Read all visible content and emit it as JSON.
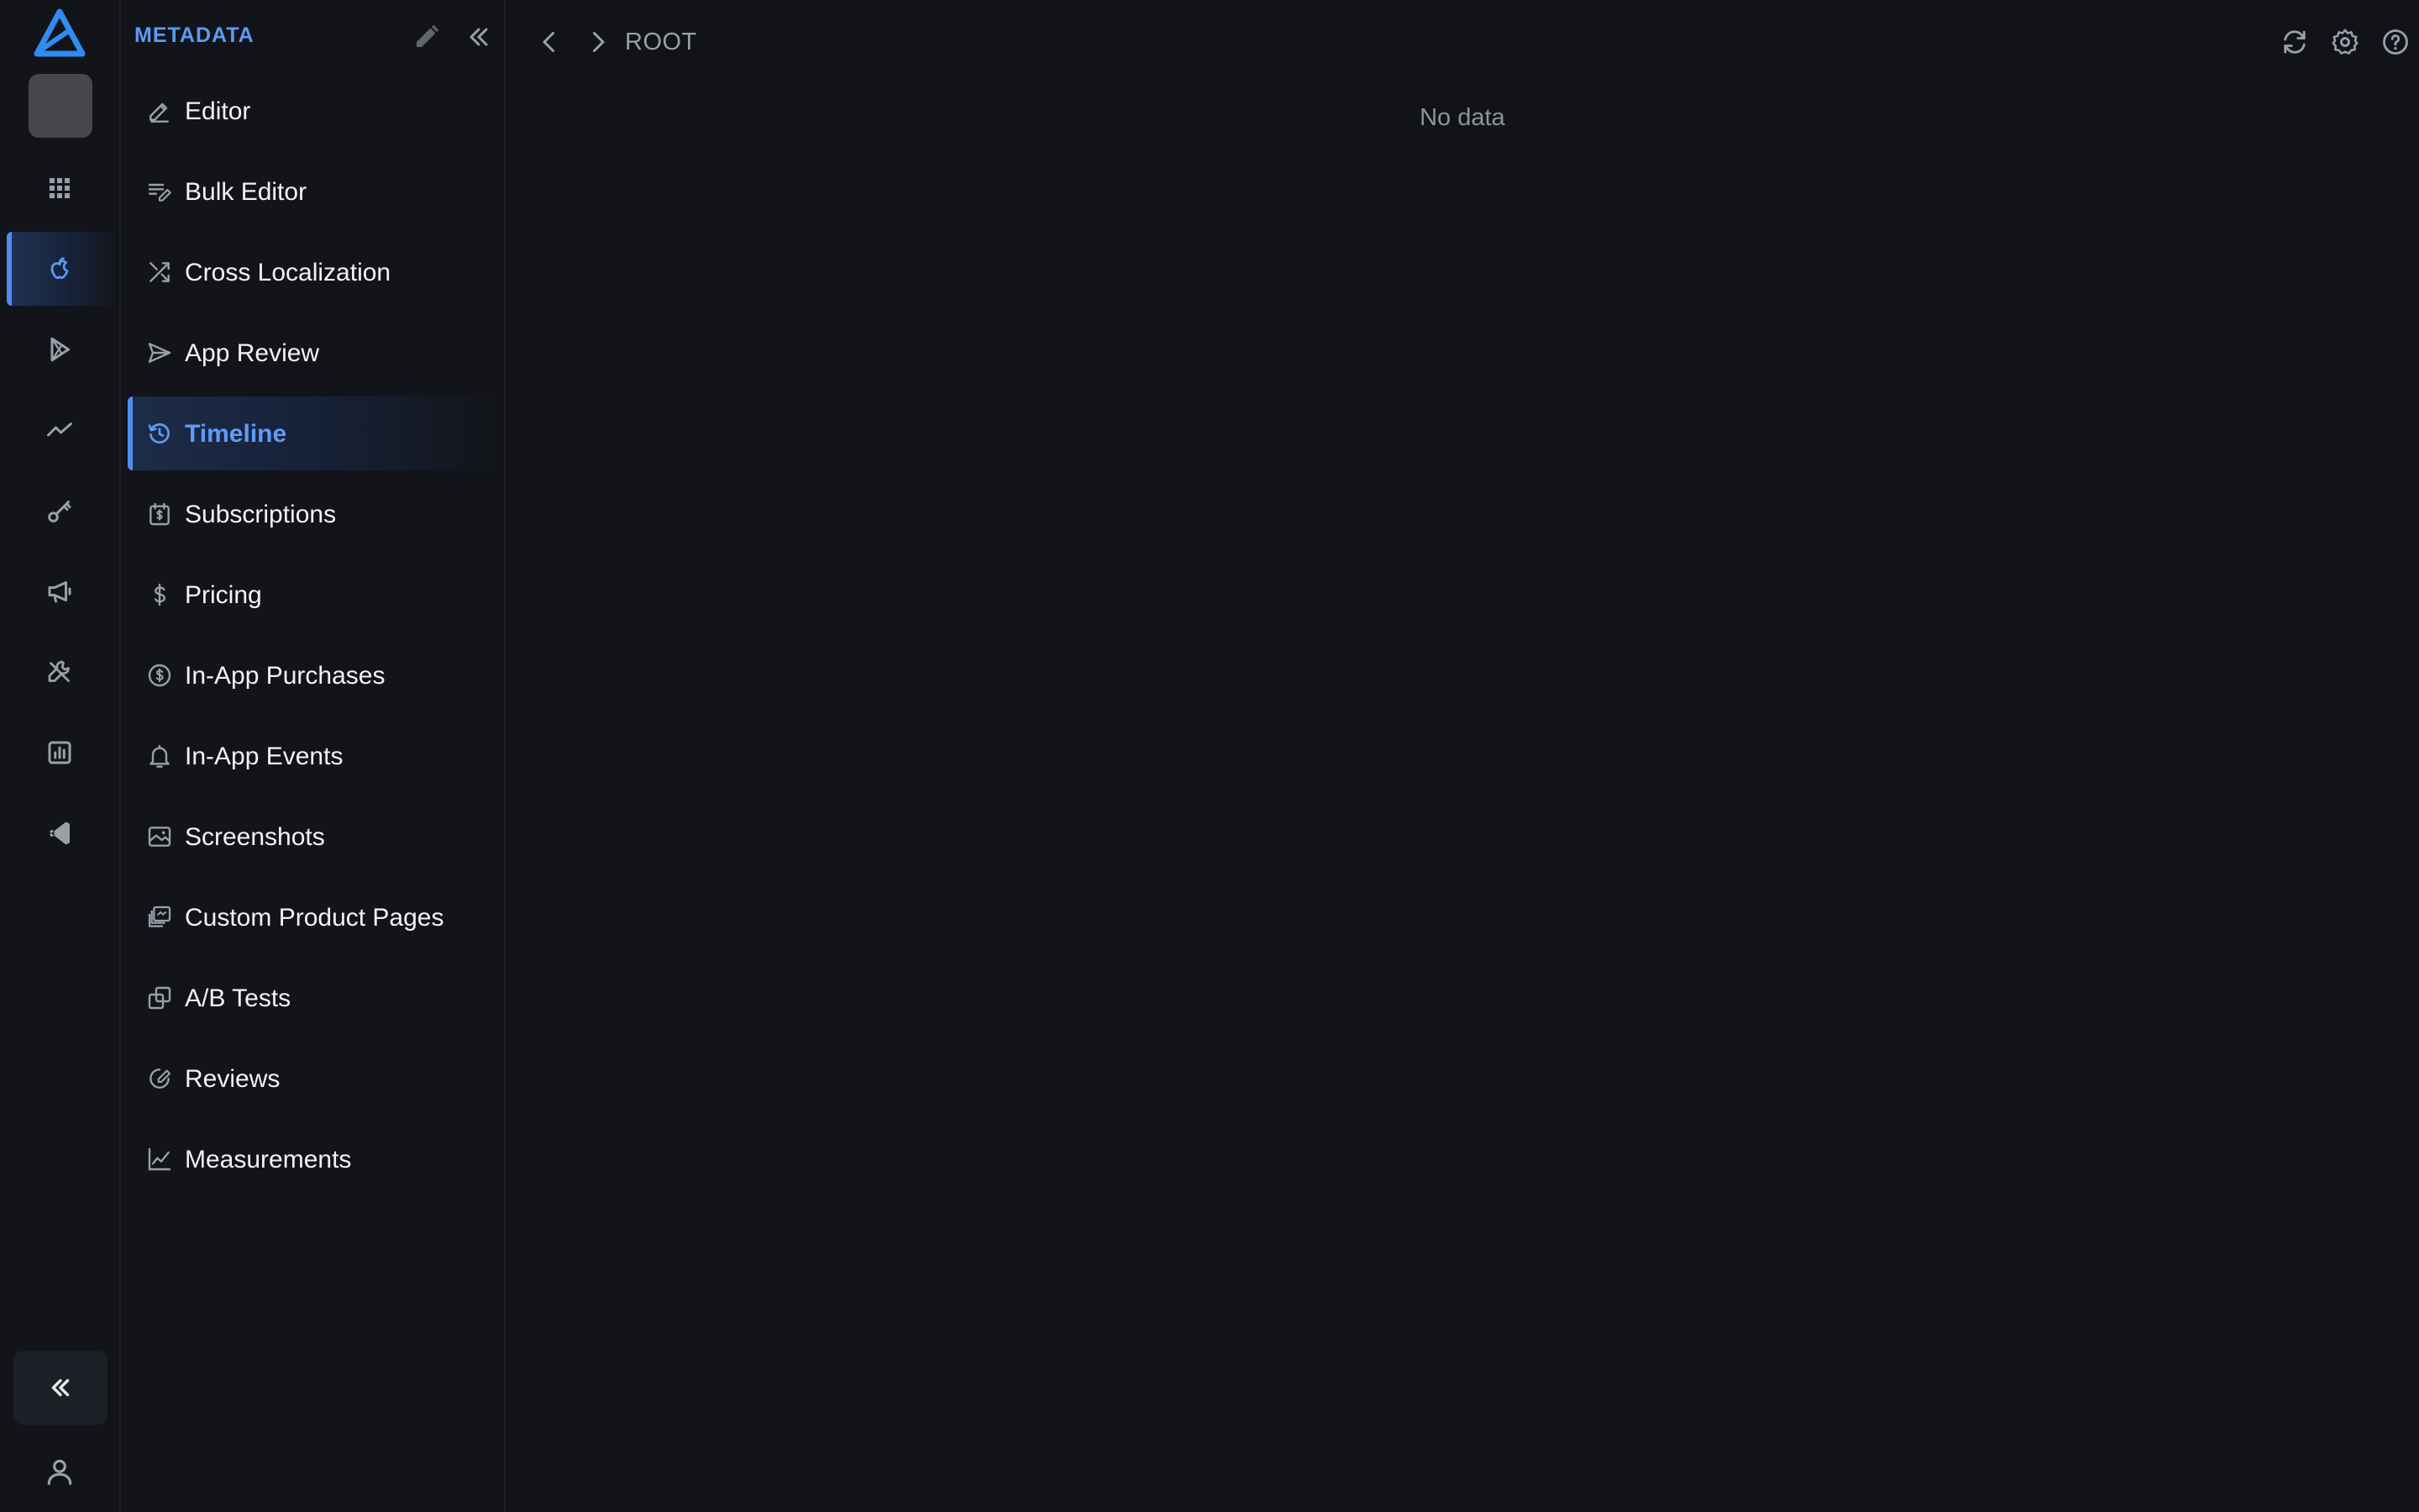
{
  "sidebar": {
    "title": "METADATA",
    "items": [
      {
        "label": "Editor",
        "icon": "pencil-icon"
      },
      {
        "label": "Bulk Editor",
        "icon": "bulk-edit-icon"
      },
      {
        "label": "Cross Localization",
        "icon": "shuffle-icon"
      },
      {
        "label": "App Review",
        "icon": "send-icon"
      },
      {
        "label": "Timeline",
        "icon": "history-icon",
        "active": true
      },
      {
        "label": "Subscriptions",
        "icon": "subscription-icon"
      },
      {
        "label": "Pricing",
        "icon": "dollar-icon"
      },
      {
        "label": "In-App Purchases",
        "icon": "coin-icon"
      },
      {
        "label": "In-App Events",
        "icon": "bell-icon"
      },
      {
        "label": "Screenshots",
        "icon": "image-icon"
      },
      {
        "label": "Custom Product Pages",
        "icon": "stack-icon"
      },
      {
        "label": "A/B Tests",
        "icon": "ab-copy-icon"
      },
      {
        "label": "Reviews",
        "icon": "review-icon"
      },
      {
        "label": "Measurements",
        "icon": "line-chart-icon"
      }
    ]
  },
  "rail": {
    "items": [
      "apps-grid-icon",
      "apple-icon",
      "play-store-icon",
      "trend-icon",
      "key-icon",
      "megaphone-icon",
      "tools-icon",
      "bar-chart-icon",
      "vscode-icon"
    ],
    "active": "apple-icon"
  },
  "header": {
    "breadcrumb": "ROOT"
  },
  "main": {
    "empty_text": "No data"
  },
  "colors": {
    "background": "#111318",
    "accent": "#4f8cf0",
    "text": "#e6e8ec",
    "muted": "#9aa0a9"
  }
}
